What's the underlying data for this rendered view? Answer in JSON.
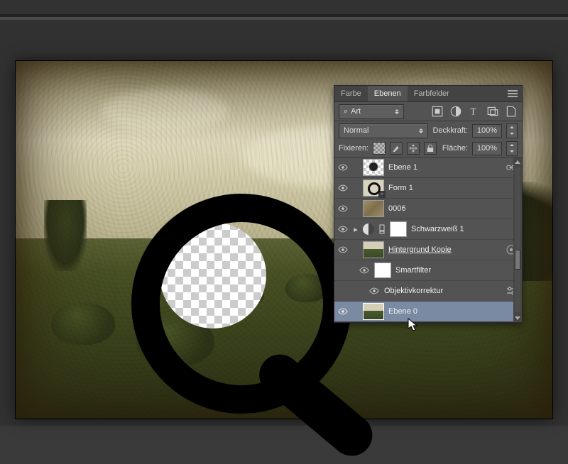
{
  "tabs": {
    "farbe": "Farbe",
    "ebenen": "Ebenen",
    "farbfelder": "Farbfelder"
  },
  "filter_row": {
    "mode_label": "Art",
    "search_icon": "search-icon"
  },
  "blend_row": {
    "mode": "Normal",
    "opacity_label": "Deckkraft:",
    "opacity_value": "100%"
  },
  "lock_row": {
    "label": "Fixieren:",
    "fill_label": "Fläche:",
    "fill_value": "100%"
  },
  "layers": [
    {
      "name": "Ebene 1",
      "kind": "transparent",
      "linked": true
    },
    {
      "name": "Form 1",
      "kind": "shape"
    },
    {
      "name": "0006",
      "kind": "texture"
    },
    {
      "name": "Schwarzweiß 1",
      "kind": "adjustment"
    },
    {
      "name": "Hintergrund Kopie",
      "kind": "smart",
      "underlined": true,
      "has_fx": true
    },
    {
      "name": "Smartfilter",
      "kind": "smartfilter_group"
    },
    {
      "name": "Objektivkorrektur",
      "kind": "smartfilter_item"
    },
    {
      "name": "Ebene 0",
      "kind": "photo",
      "selected": true
    }
  ],
  "glyphs": {
    "magnify": "⌕"
  }
}
